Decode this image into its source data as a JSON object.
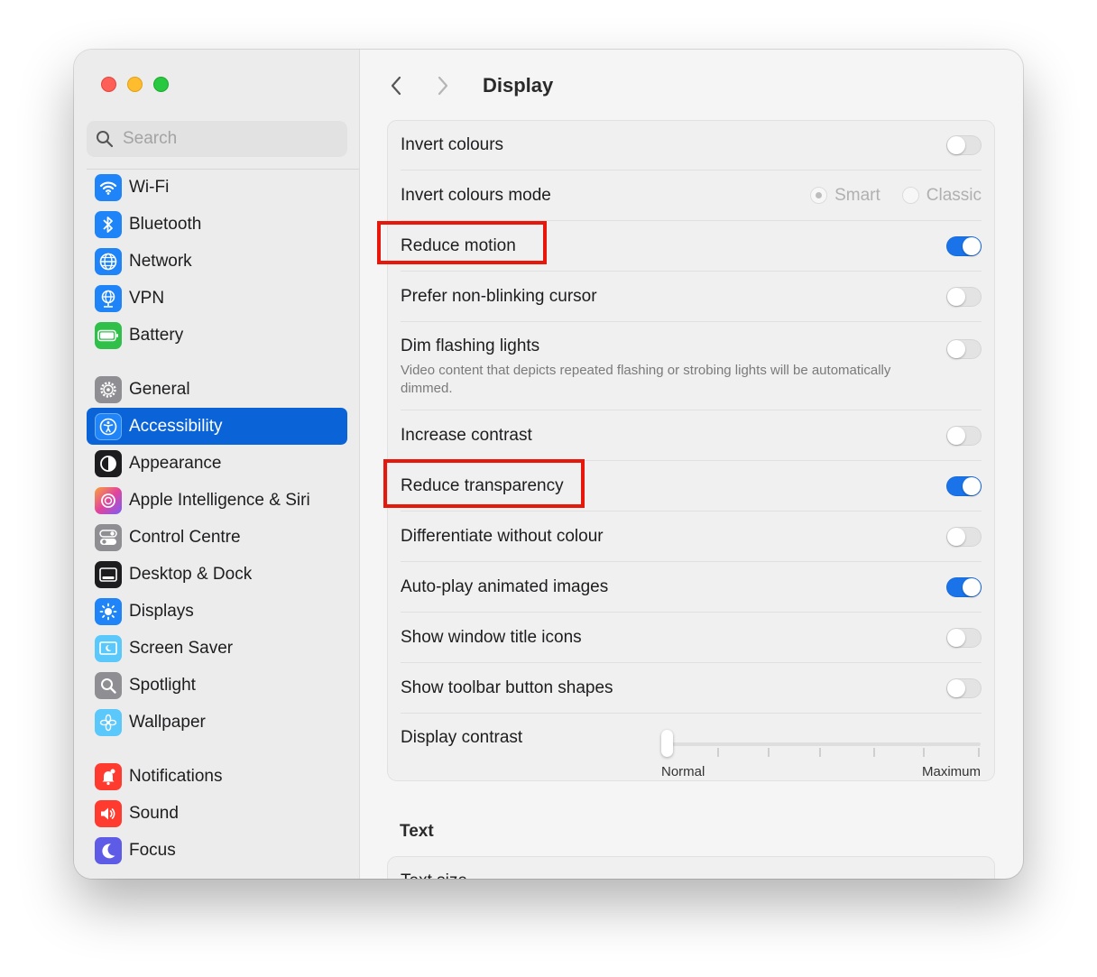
{
  "search": {
    "placeholder": "Search"
  },
  "sidebar": {
    "items": [
      {
        "label": "Wi-Fi",
        "icon": "wifi-icon",
        "color": "#1e84f7"
      },
      {
        "label": "Bluetooth",
        "icon": "bluetooth-icon",
        "color": "#1e84f7"
      },
      {
        "label": "Network",
        "icon": "globe-icon",
        "color": "#1e84f7"
      },
      {
        "label": "VPN",
        "icon": "vpn-globe-icon",
        "color": "#1e84f7"
      },
      {
        "label": "Battery",
        "icon": "battery-icon",
        "color": "#30c04a"
      },
      {
        "label": "General",
        "icon": "gear-icon",
        "color": "#8e8e93"
      },
      {
        "label": "Accessibility",
        "icon": "accessibility-icon",
        "color": "#1e84f7"
      },
      {
        "label": "Appearance",
        "icon": "appearance-icon",
        "color": "#1d1d1f"
      },
      {
        "label": "Apple Intelligence & Siri",
        "icon": "siri-icon",
        "color": "#d65cc5"
      },
      {
        "label": "Control Centre",
        "icon": "control-centre-icon",
        "color": "#8e8e93"
      },
      {
        "label": "Desktop & Dock",
        "icon": "dock-icon",
        "color": "#1d1d1f"
      },
      {
        "label": "Displays",
        "icon": "sun-icon",
        "color": "#1e84f7"
      },
      {
        "label": "Screen Saver",
        "icon": "screen-saver-icon",
        "color": "#5ac8fa"
      },
      {
        "label": "Spotlight",
        "icon": "magnifier-icon",
        "color": "#8e8e93"
      },
      {
        "label": "Wallpaper",
        "icon": "flower-icon",
        "color": "#5ac8fa"
      },
      {
        "label": "Notifications",
        "icon": "bell-icon",
        "color": "#ff3b30"
      },
      {
        "label": "Sound",
        "icon": "speaker-icon",
        "color": "#ff3b30"
      },
      {
        "label": "Focus",
        "icon": "moon-icon",
        "color": "#5e5ce6"
      }
    ],
    "active": "Accessibility"
  },
  "main": {
    "title": "Display",
    "rows": {
      "invert_colours": {
        "label": "Invert colours",
        "on": false
      },
      "invert_mode": {
        "label": "Invert colours mode",
        "options": [
          "Smart",
          "Classic"
        ],
        "selected": "Smart"
      },
      "reduce_motion": {
        "label": "Reduce motion",
        "on": true
      },
      "non_blinking": {
        "label": "Prefer non-blinking cursor",
        "on": false
      },
      "dim_flashing": {
        "label": "Dim flashing lights",
        "sub": "Video content that depicts repeated flashing or strobing lights will be automatically dimmed.",
        "on": false
      },
      "increase_contrast": {
        "label": "Increase contrast",
        "on": false
      },
      "reduce_transparency": {
        "label": "Reduce transparency",
        "on": true
      },
      "differentiate": {
        "label": "Differentiate without colour",
        "on": false
      },
      "autoplay": {
        "label": "Auto-play animated images",
        "on": true
      },
      "title_icons": {
        "label": "Show window title icons",
        "on": false
      },
      "toolbar_shapes": {
        "label": "Show toolbar button shapes",
        "on": false
      },
      "display_contrast": {
        "label": "Display contrast",
        "min_label": "Normal",
        "max_label": "Maximum",
        "value": 0
      }
    },
    "text_section": {
      "title": "Text",
      "first_row": "Text size"
    }
  },
  "colors": {
    "accent": "#0a64d8",
    "toggle_on": "#1a73e8",
    "highlight": "#e8170c"
  }
}
